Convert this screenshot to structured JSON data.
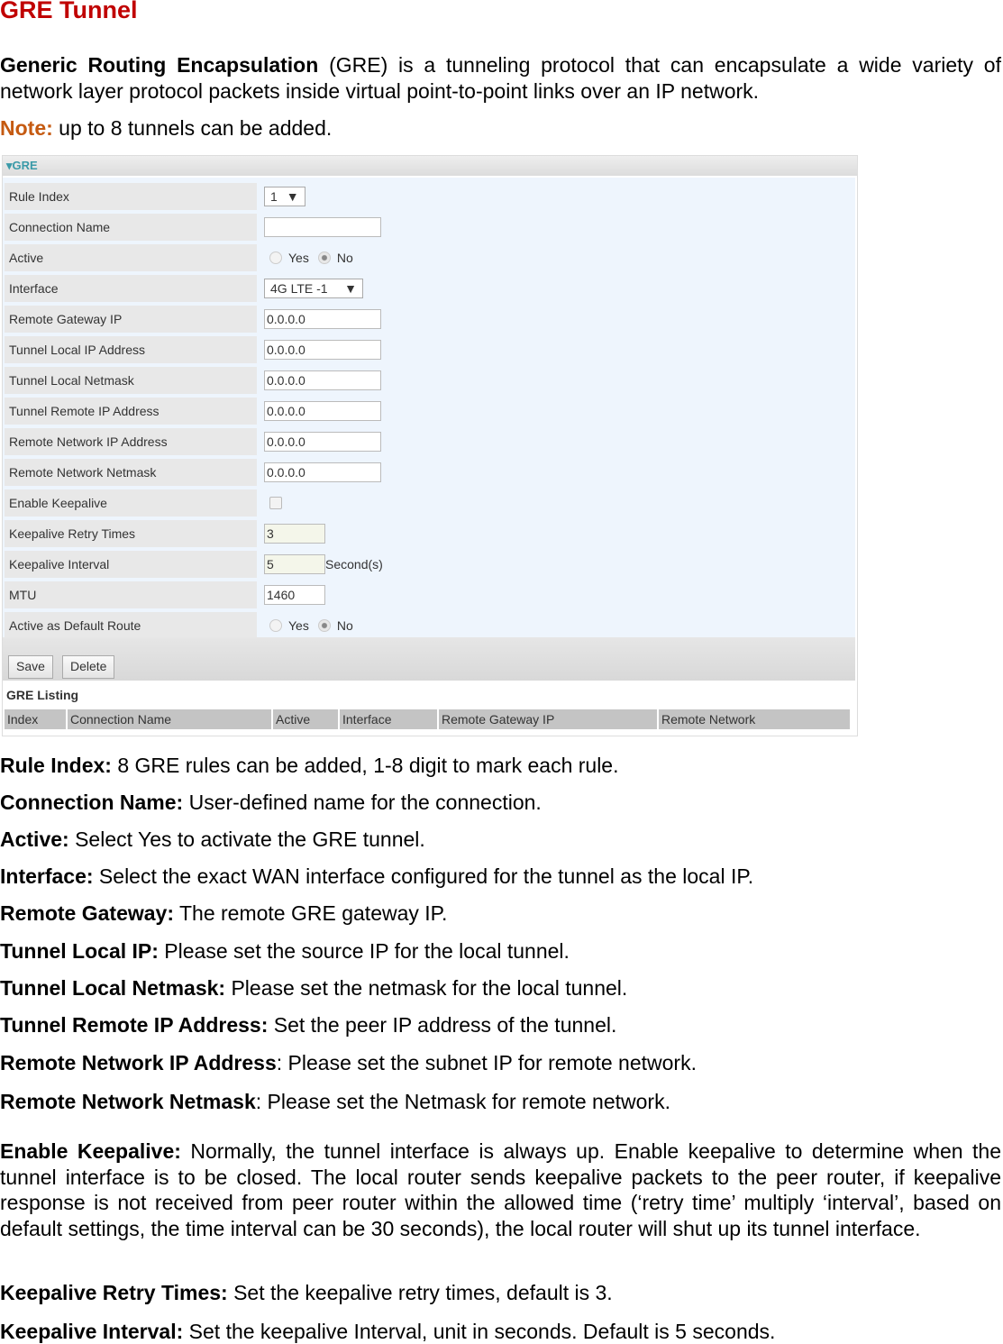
{
  "title": "GRE Tunnel",
  "intro": {
    "term": "Generic Routing Encapsulation",
    "text": " (GRE) is a tunneling protocol that can encapsulate a wide variety of network layer protocol packets inside virtual point-to-point links over an IP network."
  },
  "note": {
    "label": "Note:",
    "text": " up to 8 tunnels can be added."
  },
  "panel": {
    "header": "GRE",
    "fields": {
      "rule_index": {
        "label": "Rule Index",
        "value": "1"
      },
      "connection_name": {
        "label": "Connection Name",
        "value": ""
      },
      "active": {
        "label": "Active",
        "yes": "Yes",
        "no": "No",
        "selected": "No"
      },
      "interface": {
        "label": "Interface",
        "value": "4G LTE -1"
      },
      "remote_gateway_ip": {
        "label": "Remote Gateway IP",
        "value": "0.0.0.0"
      },
      "tunnel_local_ip": {
        "label": "Tunnel Local IP Address",
        "value": "0.0.0.0"
      },
      "tunnel_local_netmask": {
        "label": "Tunnel Local Netmask",
        "value": "0.0.0.0"
      },
      "tunnel_remote_ip": {
        "label": "Tunnel Remote IP Address",
        "value": "0.0.0.0"
      },
      "remote_network_ip": {
        "label": "Remote Network IP Address",
        "value": "0.0.0.0"
      },
      "remote_network_netmask": {
        "label": "Remote Network Netmask",
        "value": "0.0.0.0"
      },
      "enable_keepalive": {
        "label": "Enable Keepalive",
        "checked": false
      },
      "keepalive_retry": {
        "label": "Keepalive Retry Times",
        "value": "3"
      },
      "keepalive_interval": {
        "label": "Keepalive Interval",
        "value": "5",
        "unit": "Second(s)"
      },
      "mtu": {
        "label": "MTU",
        "value": "1460"
      },
      "default_route": {
        "label": "Active as Default Route",
        "yes": "Yes",
        "no": "No",
        "selected": "No"
      }
    },
    "save": "Save",
    "delete": "Delete",
    "listing_title": "GRE Listing",
    "columns": [
      "Index",
      "Connection Name",
      "Active",
      "Interface",
      "Remote Gateway IP",
      "Remote Network"
    ]
  },
  "descriptions": [
    {
      "term": "Rule Index:",
      "text": " 8 GRE rules can be added, 1-8 digit to mark each rule."
    },
    {
      "term": "Connection Name:",
      "text": " User-defined name for the connection."
    },
    {
      "term": "Active:",
      "text": " Select Yes to activate the GRE tunnel."
    },
    {
      "term": "Interface:",
      "text": " Select the exact WAN interface configured for the tunnel as the local IP."
    },
    {
      "term": "Remote Gateway:",
      "text": " The remote GRE gateway IP."
    },
    {
      "term": "Tunnel Local IP:",
      "text": " Please set the source IP for the local tunnel."
    },
    {
      "term": "Tunnel Local Netmask:",
      "text": " Please set the netmask for the local tunnel."
    },
    {
      "term": "Tunnel Remote IP Address:",
      "text": " Set the peer IP address of the tunnel."
    },
    {
      "term": "Remote Network IP Address",
      "text": ": Please set the subnet IP for remote network."
    },
    {
      "term": "Remote Network Netmask",
      "text": ": Please set the Netmask for remote network."
    },
    {
      "term": "Enable Keepalive:",
      "text": " Normally, the tunnel interface is always up. Enable keepalive to determine when the tunnel interface is to be closed. The local router sends keepalive packets to the peer router, if keepalive response is not received from peer router within the allowed time (‘retry time’ multiply ‘interval’, based on default settings, the time interval can be 30 seconds), the local router will shut up its tunnel interface."
    },
    {
      "term": "Keepalive Retry Times:",
      "text": " Set the keepalive retry times, default is 3."
    },
    {
      "term": "Keepalive Interval:",
      "text": " Set the keepalive Interval, unit in seconds. Default is 5 seconds."
    }
  ]
}
